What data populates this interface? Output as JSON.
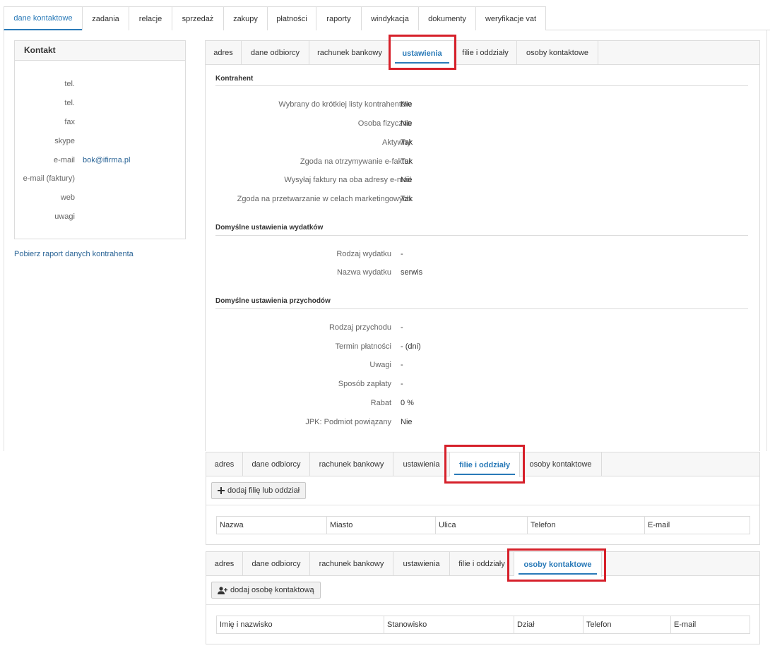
{
  "top_tabs": [
    {
      "label": "dane kontaktowe",
      "active": true
    },
    {
      "label": "zadania"
    },
    {
      "label": "relacje"
    },
    {
      "label": "sprzedaż"
    },
    {
      "label": "zakupy"
    },
    {
      "label": "płatności"
    },
    {
      "label": "raporty"
    },
    {
      "label": "windykacja"
    },
    {
      "label": "dokumenty"
    },
    {
      "label": "weryfikacje vat"
    }
  ],
  "contact": {
    "title": "Kontakt",
    "rows": [
      {
        "label": "tel.",
        "value": ""
      },
      {
        "label": "tel.",
        "value": ""
      },
      {
        "label": "fax",
        "value": ""
      },
      {
        "label": "skype",
        "value": ""
      },
      {
        "label": "e-mail",
        "value": "bok@ifirma.pl"
      },
      {
        "label": "e-mail (faktury)",
        "value": ""
      },
      {
        "label": "web",
        "value": ""
      },
      {
        "label": "uwagi",
        "value": ""
      }
    ]
  },
  "report_link": "Pobierz raport danych kontrahenta",
  "subtabs": [
    "adres",
    "dane odbiorcy",
    "rachunek bankowy",
    "ustawienia",
    "filie i oddziały",
    "osoby kontaktowe"
  ],
  "settings": {
    "sections": [
      {
        "title": "Kontrahent",
        "rows": [
          {
            "label": "Wybrany do krótkiej listy kontrahentów",
            "value": "Nie"
          },
          {
            "label": "Osoba fizyczna",
            "value": "Nie"
          },
          {
            "label": "Aktywny",
            "value": "Tak"
          },
          {
            "label": "Zgoda na otrzymywanie e-faktur",
            "value": "Tak"
          },
          {
            "label": "Wysyłaj faktury na oba adresy e-mail",
            "value": "Nie"
          },
          {
            "label": "Zgoda na przetwarzanie w celach marketingowych",
            "value": "Tak"
          }
        ]
      },
      {
        "title": "Domyślne ustawienia wydatków",
        "rows": [
          {
            "label": "Rodzaj wydatku",
            "value": "-"
          },
          {
            "label": "Nazwa wydatku",
            "value": "serwis"
          }
        ]
      },
      {
        "title": "Domyślne ustawienia przychodów",
        "rows": [
          {
            "label": "Rodzaj przychodu",
            "value": "-"
          },
          {
            "label": "Termin płatności",
            "value": "- (dni)"
          },
          {
            "label": "Uwagi",
            "value": "-"
          },
          {
            "label": "Sposób zapłaty",
            "value": "-"
          },
          {
            "label": "Rabat",
            "value": "0 %"
          },
          {
            "label": "JPK: Podmiot powiązany",
            "value": "Nie"
          }
        ]
      }
    ]
  },
  "branches": {
    "add_button": "dodaj filię lub oddział",
    "columns": [
      "Nazwa",
      "Miasto",
      "Ulica",
      "Telefon",
      "E-mail"
    ]
  },
  "contacts": {
    "add_button": "dodaj osobę kontaktową",
    "columns": [
      "Imię i nazwisko",
      "Stanowisko",
      "Dział",
      "Telefon",
      "E-mail"
    ]
  },
  "colors": {
    "accent": "#2a7ab8",
    "highlight": "#d6202a"
  },
  "icons": {
    "plus": "plus-icon",
    "add_person": "add-person-icon"
  }
}
